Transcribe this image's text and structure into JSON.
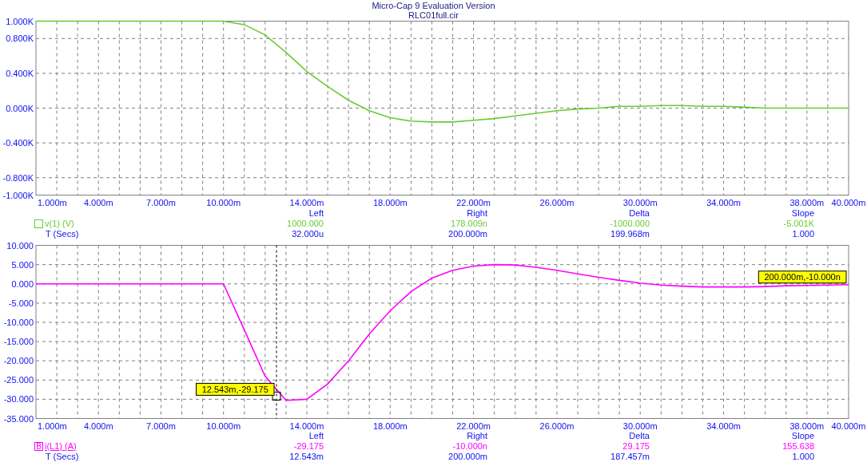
{
  "window": {
    "title": "Micro-Cap 9 Evaluation Version",
    "file": "RLC01full.cir"
  },
  "plots": [
    {
      "trace": {
        "selected": false
      },
      "readout": {
        "headers": [
          "Left",
          "Right",
          "Delta",
          "Slope"
        ],
        "trace_values": [
          "1000.000",
          "178.009n",
          "-1000.000",
          "-5.001K"
        ],
        "x_label": "T (Secs)",
        "x_values": [
          "32.000u",
          "200.000m",
          "199.968m",
          "1.000"
        ]
      },
      "chart_data": {
        "type": "line",
        "xlim": [
          1,
          40
        ],
        "ylim": [
          -1000,
          1000
        ],
        "xticks": [
          {
            "value": 1,
            "label": "1.000m"
          },
          {
            "value": 4,
            "label": "4.000m"
          },
          {
            "value": 7,
            "label": "7.000m"
          },
          {
            "value": 10,
            "label": "10.000m"
          },
          {
            "value": 14,
            "label": "14.000m"
          },
          {
            "value": 18,
            "label": "18.000m"
          },
          {
            "value": 22,
            "label": "22.000m"
          },
          {
            "value": 26,
            "label": "26.000m"
          },
          {
            "value": 30,
            "label": "30.000m"
          },
          {
            "value": 34,
            "label": "34.000m"
          },
          {
            "value": 38,
            "label": "38.000m"
          },
          {
            "value": 40,
            "label": "40.000m"
          }
        ],
        "yticks": [
          {
            "value": 1000,
            "label": "1.000K"
          },
          {
            "value": 800,
            "label": "0.800K"
          },
          {
            "value": 400,
            "label": "0.400K"
          },
          {
            "value": 0,
            "label": "0.000K"
          },
          {
            "value": -400,
            "label": "-0.400K"
          },
          {
            "value": -800,
            "label": "-0.800K"
          },
          {
            "value": -1000,
            "label": "-1.000K"
          }
        ],
        "x": [
          1,
          2,
          3,
          4,
          5,
          6,
          7,
          8,
          9,
          10,
          11,
          12,
          13,
          14,
          15,
          16,
          17,
          18,
          19,
          20,
          21,
          22,
          23,
          24,
          25,
          26,
          27,
          28,
          29,
          30,
          31,
          32,
          33,
          34,
          35,
          36,
          37,
          38,
          39,
          40
        ],
        "series": [
          {
            "name": "v(1) (V)",
            "color": "#66cc33",
            "values": [
              1000,
              1000,
              1000,
              1000,
              1000,
              1000,
              1000,
              1000,
              1000,
              1000,
              960,
              840,
              640,
              420,
              250,
              90,
              -30,
              -110,
              -150,
              -160,
              -160,
              -140,
              -120,
              -90,
              -60,
              -30,
              -10,
              0,
              20,
              20,
              30,
              30,
              20,
              20,
              10,
              0,
              0,
              0,
              0,
              0
            ]
          }
        ],
        "grid": true
      }
    },
    {
      "trace": {
        "selected": true,
        "badge": "B"
      },
      "readout": {
        "headers": [
          "Left",
          "Right",
          "Delta",
          "Slope"
        ],
        "trace_values": [
          "-29.175",
          "-10.000n",
          "29.175",
          "155.638"
        ],
        "x_label": "T (Secs)",
        "x_values": [
          "12.543m",
          "200.000m",
          "187.457m",
          "1.000"
        ]
      },
      "chart_data": {
        "type": "line",
        "xlim": [
          1,
          40
        ],
        "ylim": [
          -35,
          10
        ],
        "xticks": [
          {
            "value": 1,
            "label": "1.000m"
          },
          {
            "value": 4,
            "label": "4.000m"
          },
          {
            "value": 7,
            "label": "7.000m"
          },
          {
            "value": 10,
            "label": "10.000m"
          },
          {
            "value": 14,
            "label": "14.000m"
          },
          {
            "value": 18,
            "label": "18.000m"
          },
          {
            "value": 22,
            "label": "22.000m"
          },
          {
            "value": 26,
            "label": "26.000m"
          },
          {
            "value": 30,
            "label": "30.000m"
          },
          {
            "value": 34,
            "label": "34.000m"
          },
          {
            "value": 38,
            "label": "38.000m"
          },
          {
            "value": 40,
            "label": "40.000m"
          }
        ],
        "yticks": [
          {
            "value": 10,
            "label": "10.000"
          },
          {
            "value": 5,
            "label": "5.000"
          },
          {
            "value": 0,
            "label": "0.000"
          },
          {
            "value": -5,
            "label": "-5.000"
          },
          {
            "value": -10,
            "label": "-10.000"
          },
          {
            "value": -15,
            "label": "-15.000"
          },
          {
            "value": -20,
            "label": "-20.000"
          },
          {
            "value": -25,
            "label": "-25.000"
          },
          {
            "value": -30,
            "label": "-30.000"
          },
          {
            "value": -35,
            "label": "-35.000"
          }
        ],
        "x": [
          1,
          2,
          3,
          4,
          5,
          6,
          7,
          8,
          9,
          10,
          11,
          12,
          13,
          14,
          15,
          16,
          17,
          18,
          19,
          20,
          21,
          22,
          23,
          24,
          25,
          26,
          27,
          28,
          29,
          30,
          31,
          32,
          33,
          34,
          35,
          36,
          37,
          38,
          39,
          40
        ],
        "series": [
          {
            "name": "i(L1) (A)",
            "color": "#ff00ff",
            "values": [
              0,
              0,
              0,
              0,
              0,
              0,
              0,
              0,
              0,
              0,
              -12,
              -24,
              -30.3,
              -30,
              -26,
              -20,
              -13,
              -7,
              -2,
              1.5,
              3.5,
              4.6,
              5,
              4.9,
              4.3,
              3.5,
              2.6,
              1.7,
              0.9,
              0.2,
              -0.3,
              -0.6,
              -0.8,
              -0.8,
              -0.8,
              -0.7,
              -0.5,
              -0.4,
              -0.3,
              -0.2
            ]
          }
        ],
        "grid": true,
        "ref_lines": [
          {
            "axis": "x",
            "value": 12.543,
            "color": "#000000"
          }
        ],
        "annotations": [
          {
            "x": 12.543,
            "y": -29.175,
            "text": "12.543m,-29.175"
          },
          {
            "x": 40,
            "y": 0,
            "text": "200.000m,-10.000n"
          }
        ]
      }
    }
  ]
}
